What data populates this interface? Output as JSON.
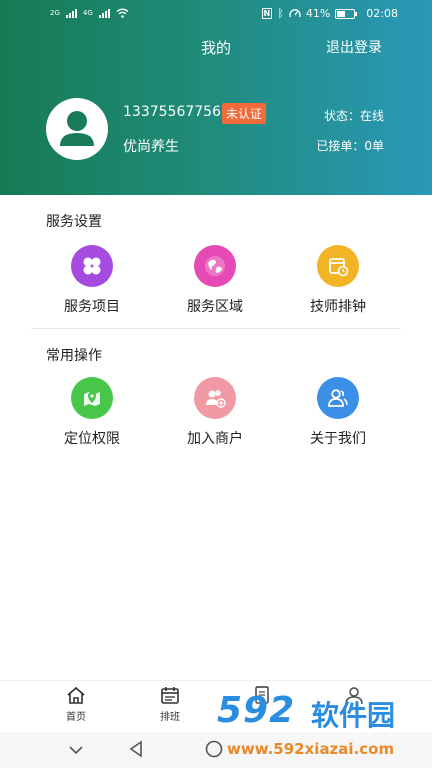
{
  "status_bar": {
    "network_left": "2G",
    "network_right": "4G",
    "nfc_icon": "N",
    "battery": "41%",
    "time": "02:08"
  },
  "header": {
    "title": "我的",
    "logout": "退出登录"
  },
  "profile": {
    "phone": "13375567756",
    "badge": "未认证",
    "name": "优尚养生",
    "status": "状态：在线",
    "orders": "已接单：0单"
  },
  "service_settings": {
    "title": "服务设置",
    "items": [
      {
        "label": "服务项目",
        "icon": "four-petal-icon",
        "color": "#a54be0"
      },
      {
        "label": "服务区域",
        "icon": "globe-icon",
        "color": "#e64ab4"
      },
      {
        "label": "技师排钟",
        "icon": "calendar-clock-icon",
        "color": "#f2b324"
      }
    ]
  },
  "common_operations": {
    "title": "常用操作",
    "items": [
      {
        "label": "定位权限",
        "icon": "map-pin-icon",
        "color": "#47c64a"
      },
      {
        "label": "加入商户",
        "icon": "users-add-icon",
        "color": "#f19aa5"
      },
      {
        "label": "关于我们",
        "icon": "users-icon",
        "color": "#3b8fe6"
      }
    ]
  },
  "tabbar": {
    "items": [
      {
        "label": "首页",
        "icon": "home-icon"
      },
      {
        "label": "排班",
        "icon": "calendar-icon"
      },
      {
        "label": "",
        "icon": "document-icon"
      },
      {
        "label": "",
        "icon": "user-icon"
      }
    ]
  },
  "watermark": {
    "brand": "592",
    "brand_cn": "软件园",
    "url": "www.592xiazai.com"
  },
  "colors": {
    "header_start": "#167a54",
    "header_end": "#2a98b8",
    "badge": "#f16a3a",
    "watermark_blue": "#2b8de0",
    "watermark_orange": "#e8892a"
  }
}
